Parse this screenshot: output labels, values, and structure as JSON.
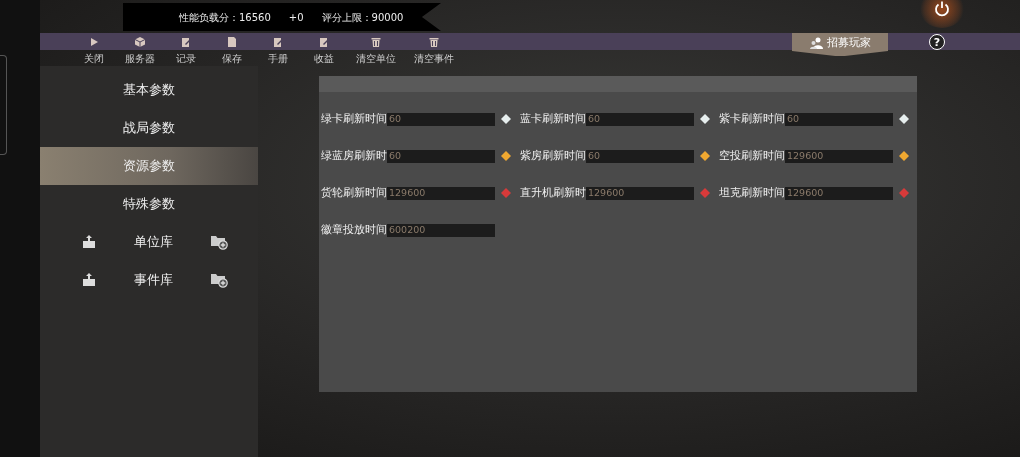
{
  "score_bar": {
    "load_label": "性能负载分：16560",
    "delta": "+0",
    "limit_label": "评分上限：90000"
  },
  "toolbar": [
    {
      "label": "关闭",
      "kind": "play"
    },
    {
      "label": "服务器",
      "kind": "cube"
    },
    {
      "label": "记录",
      "kind": "edit"
    },
    {
      "label": "保存",
      "kind": "file"
    },
    {
      "label": "手册",
      "kind": "edit"
    },
    {
      "label": "收益",
      "kind": "edit"
    },
    {
      "label": "清空单位",
      "kind": "trash"
    },
    {
      "label": "清空事件",
      "kind": "trash"
    }
  ],
  "recruit_button": {
    "label": "招募玩家"
  },
  "help_button": {
    "label": "?"
  },
  "sidebar": {
    "items": [
      {
        "kind": "tab",
        "label": "基本参数",
        "selected": false
      },
      {
        "kind": "tab",
        "label": "战局参数",
        "selected": false
      },
      {
        "kind": "tab",
        "label": "资源参数",
        "selected": true
      },
      {
        "kind": "tab",
        "label": "特殊参数",
        "selected": false
      },
      {
        "kind": "library",
        "label": "单位库",
        "selected": false
      },
      {
        "kind": "library",
        "label": "事件库",
        "selected": false
      }
    ]
  },
  "fields": [
    {
      "label": "绿卡刷新时间",
      "value": "60",
      "color": "#e6eeee"
    },
    {
      "label": "蓝卡刷新时间",
      "value": "60",
      "color": "#e6eeee"
    },
    {
      "label": "紫卡刷新时间",
      "value": "60",
      "color": "#e6eeee"
    },
    {
      "label": "绿蓝房刷新时",
      "value": "60",
      "color": "#f0a830"
    },
    {
      "label": "紫房刷新时间",
      "value": "60",
      "color": "#f0a830"
    },
    {
      "label": "空投刷新时间",
      "value": "129600",
      "color": "#f0a830"
    },
    {
      "label": "货轮刷新时间",
      "value": "129600",
      "color": "#d83a3a"
    },
    {
      "label": "直升机刷新时",
      "value": "129600",
      "color": "#d83a3a"
    },
    {
      "label": "坦克刷新时间",
      "value": "129600",
      "color": "#d83a3a"
    },
    {
      "label": "徽章投放时间",
      "value": "600200"
    }
  ]
}
